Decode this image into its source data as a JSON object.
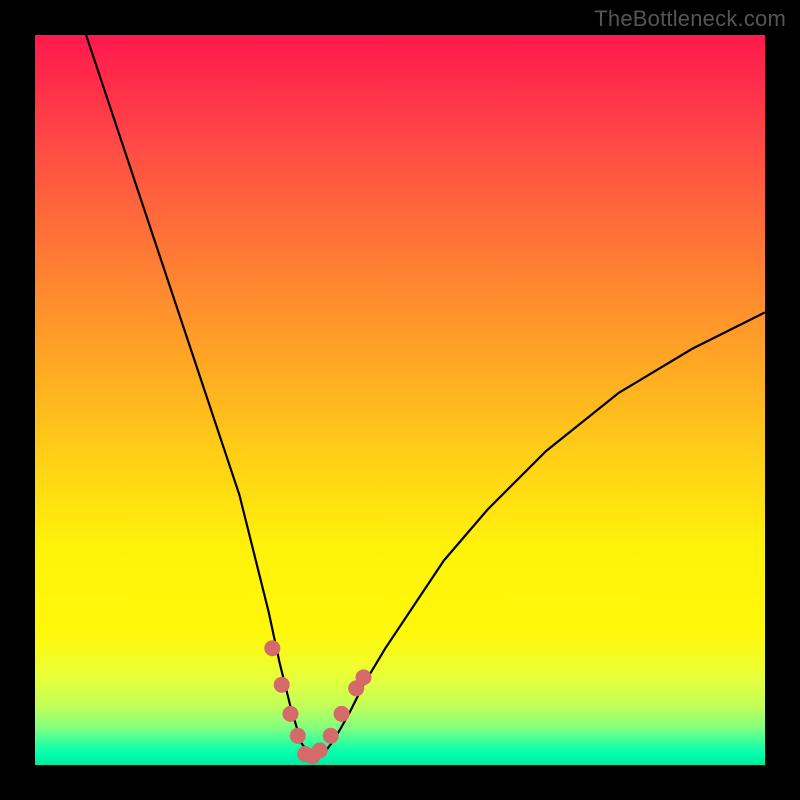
{
  "watermark": "TheBottleneck.com",
  "colors": {
    "curve": "#000000",
    "marker": "#d46a6a",
    "gradient_top": "#ff1a4d",
    "gradient_bottom": "#00e8a0"
  },
  "chart_data": {
    "type": "line",
    "title": "",
    "xlabel": "",
    "ylabel": "",
    "xlim": [
      0,
      100
    ],
    "ylim": [
      0,
      100
    ],
    "note": "x and y are percentages of the visible plot area (origin bottom-left); y≈0 is best match, y≈100 worst. Curve shows bottleneck severity vs. hardware balance; the trough near x≈37 is the optimal pairing.",
    "series": [
      {
        "name": "bottleneck-curve",
        "x": [
          7,
          10,
          13,
          16,
          19,
          22,
          25,
          28,
          30,
          32,
          33.5,
          35,
          36.5,
          38,
          39.5,
          41,
          43,
          45,
          48,
          52,
          56,
          62,
          70,
          80,
          90,
          100
        ],
        "y": [
          100,
          91,
          82,
          73,
          64,
          55,
          46,
          37,
          29,
          21,
          14,
          8,
          3,
          1,
          1.5,
          3.5,
          7,
          11,
          16,
          22,
          28,
          35,
          43,
          51,
          57,
          62
        ]
      }
    ],
    "markers": {
      "name": "highlighted-range",
      "x": [
        32.5,
        33.8,
        35.0,
        36.0,
        37.0,
        38.0,
        39.0,
        40.5,
        42.0,
        44.0,
        45.0
      ],
      "y": [
        16,
        11,
        7,
        4,
        1.5,
        1.2,
        2,
        4,
        7,
        10.5,
        12
      ]
    }
  }
}
